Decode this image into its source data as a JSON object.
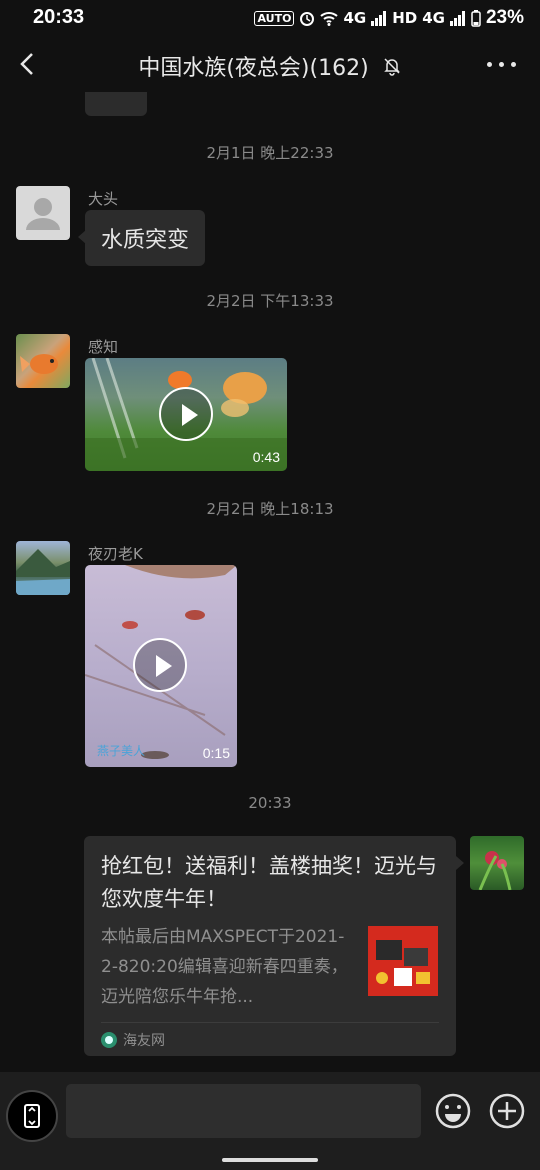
{
  "status_bar": {
    "time": "20:33",
    "auto_label": "AUTO",
    "net1": "4G",
    "hd": "HD",
    "net2": "4G",
    "battery_pct": "23%"
  },
  "header": {
    "title": "中国水族(夜总会)(162)",
    "icons": [
      "back-arrow-icon",
      "bell-muted-icon",
      "more-dots-icon"
    ]
  },
  "messages": [
    {
      "type": "timestamp",
      "text": "2月1日 晚上22:33"
    },
    {
      "type": "text",
      "sender": "大头",
      "text": "水质突变"
    },
    {
      "type": "timestamp",
      "text": "2月2日 下午13:33"
    },
    {
      "type": "video",
      "sender": "感知",
      "duration": "0:43"
    },
    {
      "type": "timestamp",
      "text": "2月2日 晚上18:13"
    },
    {
      "type": "video",
      "sender": "夜刃老K",
      "duration": "0:15",
      "watermark": "燕子美人"
    },
    {
      "type": "timestamp",
      "text": "20:33"
    },
    {
      "type": "link",
      "title": "抢红包！送福利！盖楼抽奖！迈光与您欢度牛年！",
      "description": "本帖最后由MAXSPECT于2021-2-820:20编辑喜迎新春四重奏，迈光陪您乐牛年抢...",
      "source": "海友网"
    }
  ],
  "composer": {
    "input_value": "",
    "icons": [
      "voice-switch-icon",
      "emoji-icon",
      "plus-icon"
    ]
  },
  "colors": {
    "background": "#111111",
    "bubble": "#2c2c2c",
    "timestamp_text": "#8a8a8a"
  }
}
